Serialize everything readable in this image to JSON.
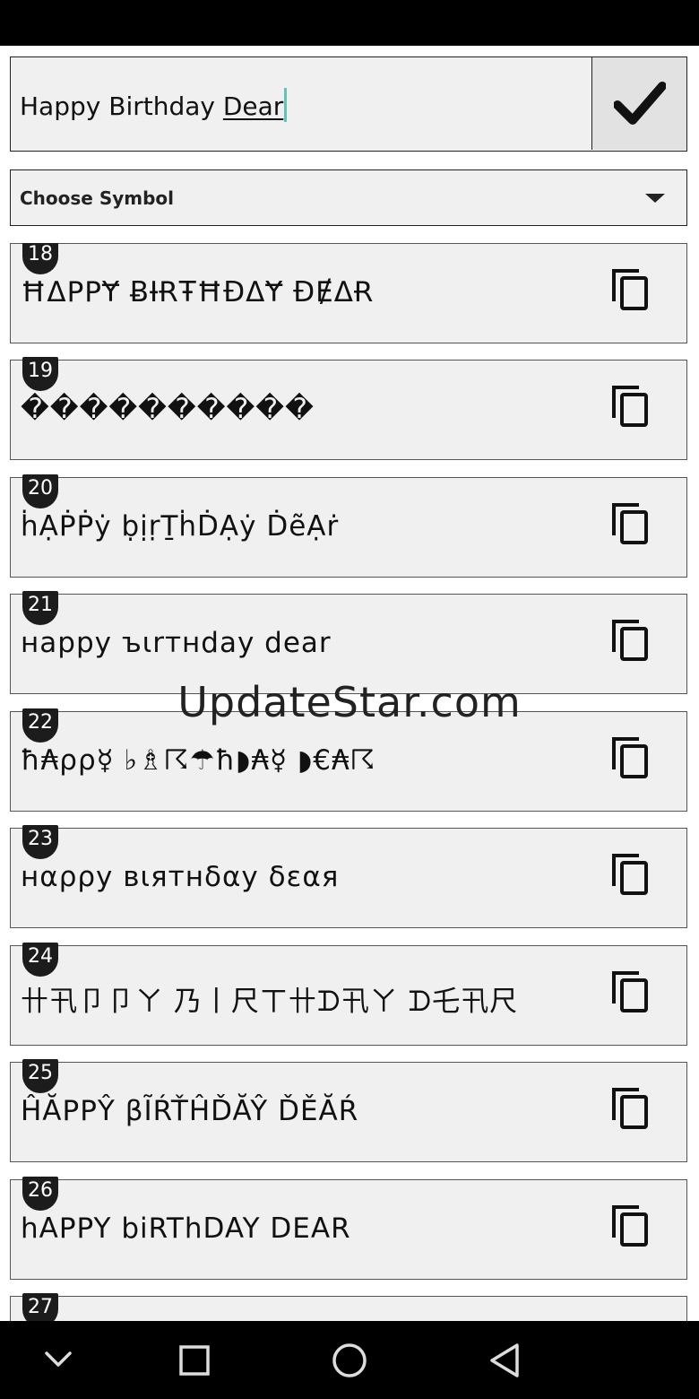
{
  "input": {
    "value_plain": "Happy Birthday ",
    "value_underlined": "Dear"
  },
  "symbol_select": {
    "label": "Choose Symbol"
  },
  "results": [
    {
      "number": "18",
      "text": "ĦΔPPɎ ɃƗɌŦĦĐΔɎ ĐɆΔɌ"
    },
    {
      "number": "19",
      "text": "����������"
    },
    {
      "number": "20",
      "text": "ḣẠṖṖẏ ḅịṛṮḣḊẠẏ ḊẽẠṙ"
    },
    {
      "number": "21",
      "text": "нappy ъιrтнday dear"
    },
    {
      "number": "22",
      "text": "ħ₳ρρ☿ ♭♗☈☂ħ◗₳☿ ◗€₳☈"
    },
    {
      "number": "23",
      "text": "нαρρу вιятнδαу δεαя"
    },
    {
      "number": "24",
      "text": "卄卂卩卩ㄚ 乃丨尺ㄒ卄ᗪ卂ㄚ ᗪ乇卂尺"
    },
    {
      "number": "25",
      "text": "ĤĂPPŶ βĨŔŤĤĎĂŶ ĎĚĂŔ"
    },
    {
      "number": "26",
      "text": "hAPPY biRThDAY DEAR"
    },
    {
      "number": "27",
      "text": ""
    }
  ],
  "watermark": "UpdateStar.com",
  "icons": {
    "confirm": "checkmark-icon",
    "copy": "copy-icon",
    "dropdown": "chevron-down-icon",
    "nav": [
      "collapse-icon",
      "recents-icon",
      "home-icon",
      "back-icon"
    ]
  },
  "colors": {
    "caret": "#5ec4b6",
    "card_bg": "#f0f0f0",
    "badge_bg": "#1c1c1c"
  }
}
